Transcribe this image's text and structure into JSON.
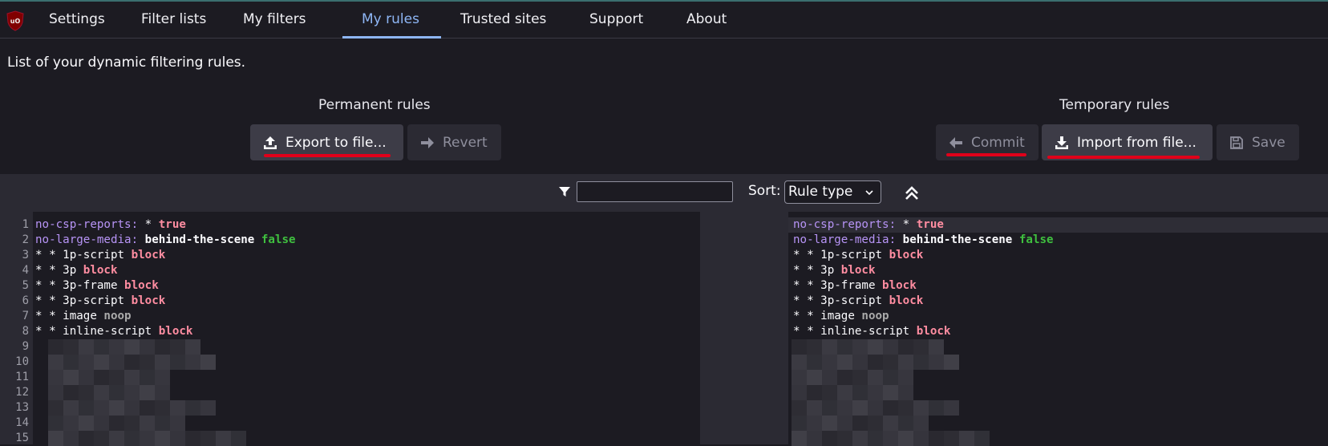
{
  "nav": {
    "tabs": [
      {
        "label": "Settings"
      },
      {
        "label": "Filter lists"
      },
      {
        "label": "My filters"
      },
      {
        "label": "My rules",
        "active": true
      },
      {
        "label": "Trusted sites"
      },
      {
        "label": "Support"
      },
      {
        "label": "About"
      }
    ]
  },
  "intro": "List of your dynamic filtering rules.",
  "permanent": {
    "title": "Permanent rules",
    "export_label": "Export to file...",
    "revert_label": "Revert"
  },
  "temporary": {
    "title": "Temporary rules",
    "commit_label": "Commit",
    "import_label": "Import from file...",
    "save_label": "Save"
  },
  "toolbar": {
    "filter_value": "",
    "sort_label": "Sort:",
    "sort_value": "Rule type"
  },
  "editor": {
    "line_numbers": [
      "1",
      "2",
      "3",
      "4",
      "5",
      "6",
      "7",
      "8",
      "9",
      "10",
      "11",
      "12",
      "13",
      "14",
      "15"
    ],
    "rules": [
      {
        "parts": [
          "no-csp-reports:",
          " * ",
          "true"
        ]
      },
      {
        "parts": [
          "no-large-media:",
          " behind-the-scene ",
          "false"
        ]
      },
      {
        "parts": [
          "* * 1p-script ",
          "block"
        ]
      },
      {
        "parts": [
          "* * 3p ",
          "block"
        ]
      },
      {
        "parts": [
          "* * 3p-frame ",
          "block"
        ]
      },
      {
        "parts": [
          "* * 3p-script ",
          "block"
        ]
      },
      {
        "parts": [
          "* * image ",
          "noop"
        ]
      },
      {
        "parts": [
          "* * inline-script ",
          "block"
        ]
      }
    ]
  },
  "colors": {
    "background": "#1c1b22",
    "accent": "#8eb6f5",
    "annotation_red": "#e0001a",
    "rule_key": "#b794f6",
    "rule_block": "#ff8da1",
    "rule_false": "#3fbf3f"
  },
  "icons": [
    "ublock-origin-logo",
    "upload-icon",
    "arrow-right-icon",
    "arrow-left-icon",
    "download-icon",
    "floppy-disk-icon",
    "filter-funnel-icon",
    "chevron-down-icon",
    "double-chevron-up-icon"
  ]
}
